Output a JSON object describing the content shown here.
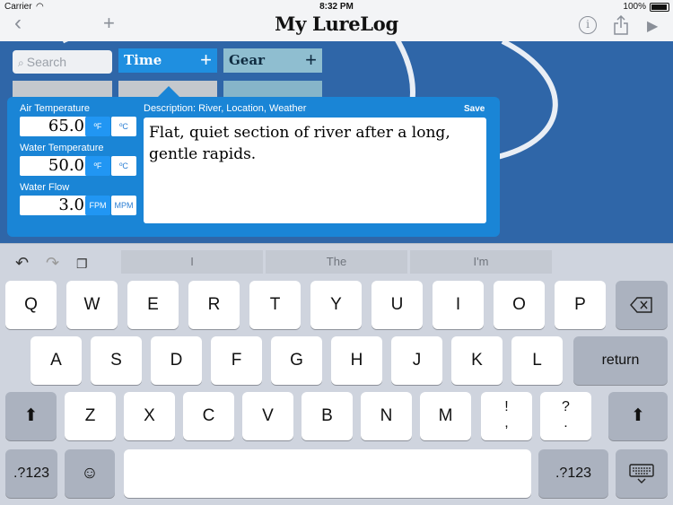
{
  "status": {
    "carrier": "Carrier",
    "time": "8:32 PM",
    "battery": "100%"
  },
  "nav": {
    "title": "My LureLog"
  },
  "search": {
    "placeholder": "Search"
  },
  "tabs": [
    {
      "label": "Time"
    },
    {
      "label": "Gear"
    }
  ],
  "popover": {
    "fields": [
      {
        "label": "Air Temperature",
        "value": "65.0",
        "units": [
          "ºF",
          "ºC"
        ],
        "selected": 0
      },
      {
        "label": "Water Temperature",
        "value": "50.0",
        "units": [
          "ºF",
          "ºC"
        ],
        "selected": 0
      },
      {
        "label": "Water Flow",
        "value": "3.0",
        "units": [
          "FPM",
          "MPM"
        ],
        "selected": 0
      }
    ],
    "description_label": "Description: River, Location, Weather",
    "save_label": "Save",
    "description_text": "Flat, quiet section of river after a long, gentle rapids."
  },
  "keyboard": {
    "suggestions": [
      "I",
      "The",
      "I'm"
    ],
    "row1": [
      "Q",
      "W",
      "E",
      "R",
      "T",
      "Y",
      "U",
      "I",
      "O",
      "P"
    ],
    "row2": [
      "A",
      "S",
      "D",
      "F",
      "G",
      "H",
      "J",
      "K",
      "L"
    ],
    "row3": [
      "Z",
      "X",
      "C",
      "V",
      "B",
      "N",
      "M",
      "!\n,",
      "?\n."
    ],
    "return_label": "return",
    "numbers_label": ".?123"
  },
  "colors": {
    "accent": "#1a85d6",
    "background": "#2f66a8",
    "tab_active": "#1f8fe0"
  }
}
